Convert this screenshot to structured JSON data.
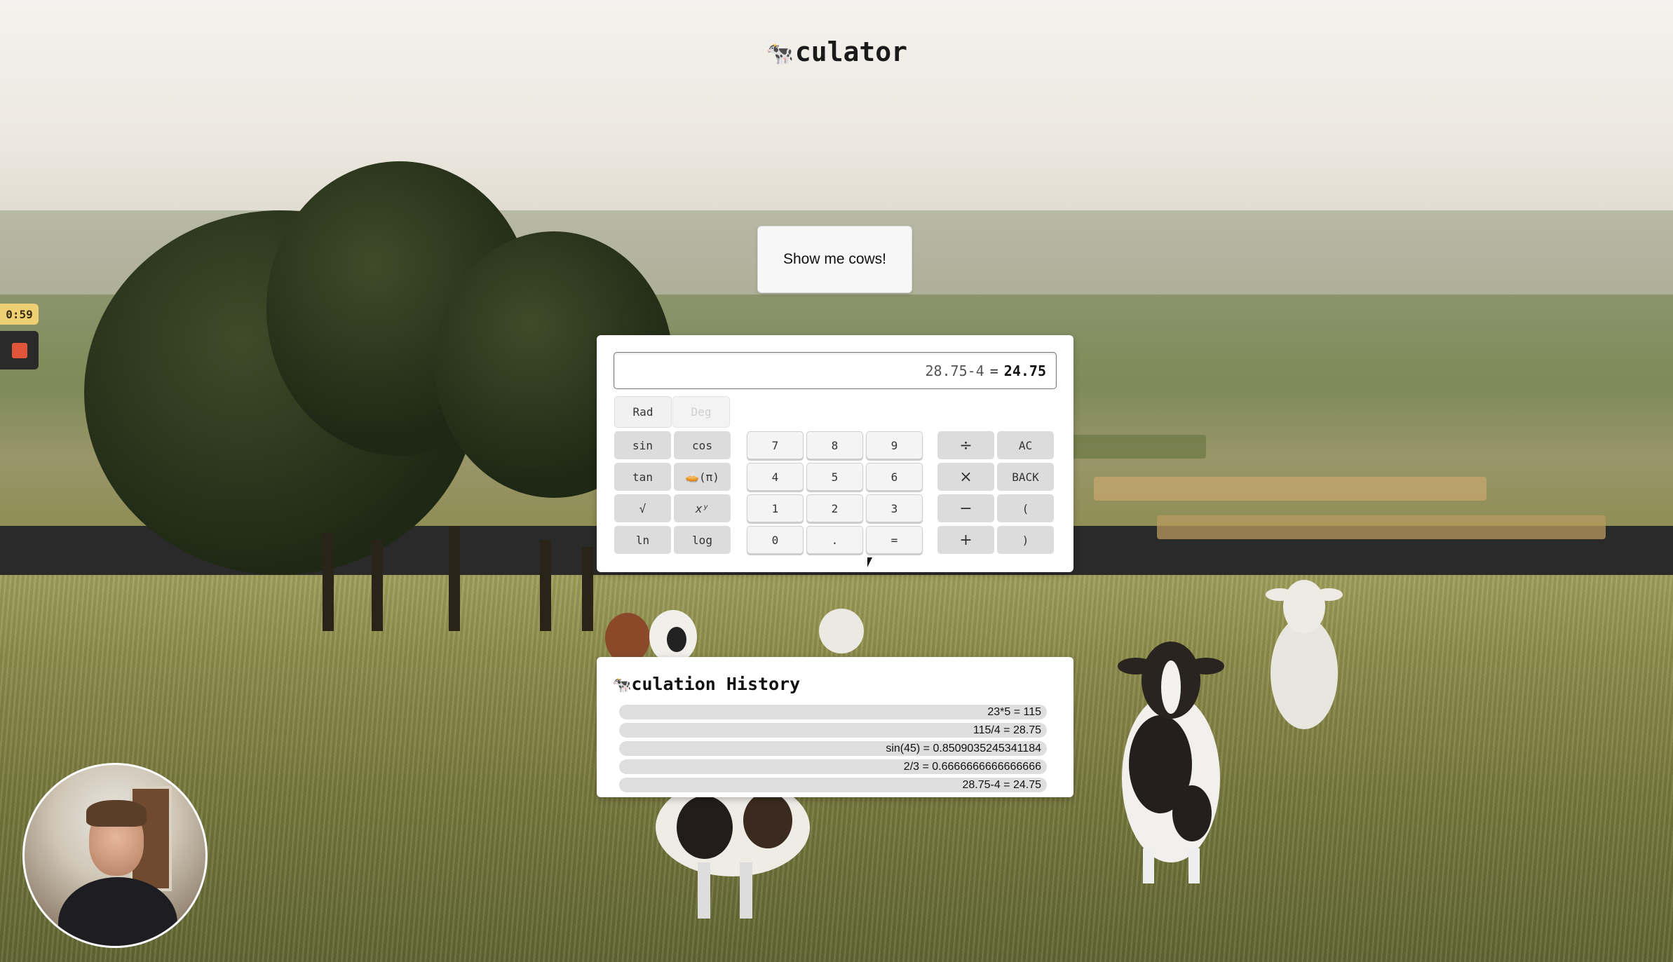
{
  "app": {
    "title_prefix_icon": "cow-icon",
    "title_text": "culator"
  },
  "show_cows_button": {
    "label": "Show me cows!"
  },
  "calculator": {
    "display": {
      "expression": "28.75-4",
      "equals": "=",
      "result": "24.75"
    },
    "mode": {
      "rad_label": "Rad",
      "deg_label": "Deg",
      "active": "Rad"
    },
    "scientific_keys": [
      {
        "label": "sin"
      },
      {
        "label": "cos"
      },
      {
        "label": "tan"
      },
      {
        "label": "🥧(π)"
      },
      {
        "label": "√"
      },
      {
        "label": "xʸ"
      },
      {
        "label": "ln"
      },
      {
        "label": "log"
      }
    ],
    "number_keys": [
      "7",
      "8",
      "9",
      "4",
      "5",
      "6",
      "1",
      "2",
      "3",
      "0",
      ".",
      "="
    ],
    "operator_keys": [
      {
        "label": "÷"
      },
      {
        "label": "AC"
      },
      {
        "label": "×"
      },
      {
        "label": "BACK"
      },
      {
        "label": "−"
      },
      {
        "label": "("
      },
      {
        "label": "+"
      },
      {
        "label": ")"
      }
    ]
  },
  "history": {
    "title_icon": "cow-icon",
    "title_text": "culation History",
    "entries": [
      "23*5 = 115",
      "115/4 = 28.75",
      "sin(45) = 0.8509035245341184",
      "2/3 = 0.6666666666666666",
      "28.75-4 = 24.75"
    ]
  },
  "recording": {
    "timer": "0:59",
    "stop_icon": "stop-icon"
  },
  "colors": {
    "timer_bg": "#efcf74",
    "stop_red": "#e1553b",
    "panel_bg": "#ffffff",
    "key_gray": "#dcdcdc"
  }
}
